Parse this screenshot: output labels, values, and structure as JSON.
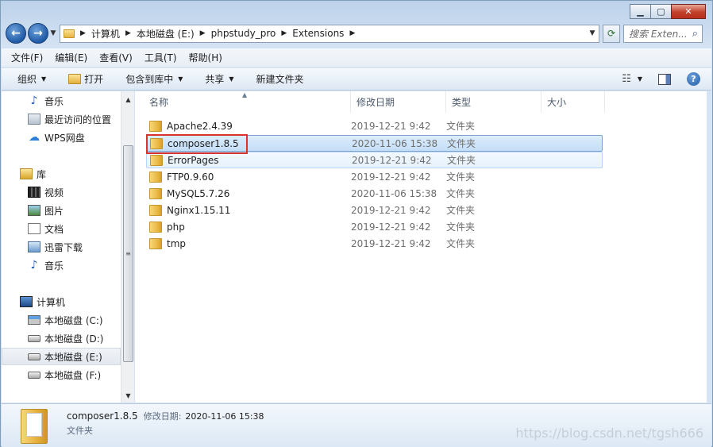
{
  "window": {
    "minimize_glyph": "▁",
    "maximize_glyph": "▢",
    "close_glyph": "✕"
  },
  "address": {
    "crumbs": [
      "计算机",
      "本地磁盘 (E:)",
      "phpstudy_pro",
      "Extensions"
    ],
    "search_placeholder": "搜索 Exten..."
  },
  "menu": [
    "文件(F)",
    "编辑(E)",
    "查看(V)",
    "工具(T)",
    "帮助(H)"
  ],
  "toolbar": {
    "organize": "组织",
    "open": "打开",
    "include_in_library": "包含到库中",
    "share": "共享",
    "new_folder": "新建文件夹"
  },
  "nav": {
    "items": [
      {
        "label": "音乐",
        "icon": "music-icon"
      },
      {
        "label": "最近访问的位置",
        "icon": "recent-places-icon"
      },
      {
        "label": "WPS网盘",
        "icon": "cloud-drive-icon"
      },
      {
        "label": "库",
        "icon": "library-icon"
      },
      {
        "label": "视频",
        "icon": "video-icon"
      },
      {
        "label": "图片",
        "icon": "picture-icon"
      },
      {
        "label": "文档",
        "icon": "document-icon"
      },
      {
        "label": "迅雷下载",
        "icon": "download-icon"
      },
      {
        "label": "音乐",
        "icon": "music-icon"
      },
      {
        "label": "计算机",
        "icon": "computer-icon"
      },
      {
        "label": "本地磁盘 (C:)",
        "icon": "system-drive-icon"
      },
      {
        "label": "本地磁盘 (D:)",
        "icon": "drive-icon"
      },
      {
        "label": "本地磁盘 (E:)",
        "icon": "drive-icon"
      },
      {
        "label": "本地磁盘 (F:)",
        "icon": "drive-icon"
      }
    ]
  },
  "columns": [
    "名称",
    "修改日期",
    "类型",
    "大小"
  ],
  "files": [
    {
      "name": "Apache2.4.39",
      "date": "2019-12-21 9:42",
      "type": "文件夹"
    },
    {
      "name": "composer1.8.5",
      "date": "2020-11-06 15:38",
      "type": "文件夹"
    },
    {
      "name": "ErrorPages",
      "date": "2019-12-21 9:42",
      "type": "文件夹"
    },
    {
      "name": "FTP0.9.60",
      "date": "2019-12-21 9:42",
      "type": "文件夹"
    },
    {
      "name": "MySQL5.7.26",
      "date": "2020-11-06 15:38",
      "type": "文件夹"
    },
    {
      "name": "Nginx1.15.11",
      "date": "2019-12-21 9:42",
      "type": "文件夹"
    },
    {
      "name": "php",
      "date": "2019-12-21 9:42",
      "type": "文件夹"
    },
    {
      "name": "tmp",
      "date": "2019-12-21 9:42",
      "type": "文件夹"
    }
  ],
  "details": {
    "name": "composer1.8.5",
    "modified_label": "修改日期:",
    "modified_value": "2020-11-06 15:38",
    "type": "文件夹"
  },
  "watermark": "https://blog.csdn.net/tgsh666",
  "colors": {
    "accent": "#1f5aa6",
    "selection": "#c4def7",
    "highlight_box": "#d9342b"
  }
}
